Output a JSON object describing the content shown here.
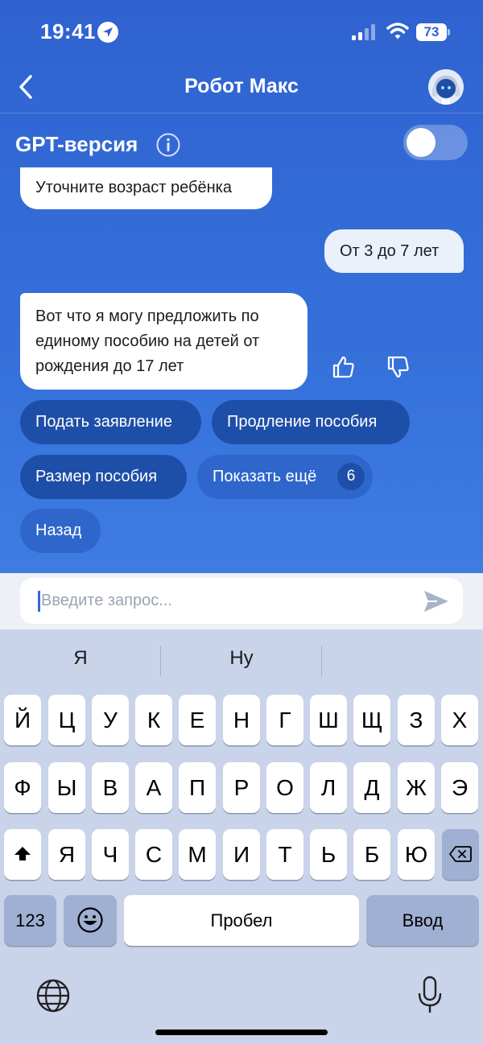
{
  "status_bar": {
    "time": "19:41",
    "battery": "73"
  },
  "header": {
    "title": "Робот Макс"
  },
  "gpt": {
    "label": "GPT-версия",
    "enabled": false
  },
  "chat": {
    "messages": [
      {
        "from": "bot",
        "text": "Уточните возраст ребёнка"
      },
      {
        "from": "user",
        "text": "От 3 до 7 лет"
      },
      {
        "from": "bot",
        "text": "Вот что я могу предложить по единому пособию на детей от рождения до 17 лет"
      }
    ],
    "quick_replies": [
      {
        "label": "Подать заявление"
      },
      {
        "label": "Продление пособия"
      },
      {
        "label": "Размер пособия"
      },
      {
        "label": "Показать ещё",
        "count": "6"
      },
      {
        "label": "Назад"
      }
    ]
  },
  "input": {
    "placeholder": "Введите запрос..."
  },
  "keyboard": {
    "suggestions": [
      "Я",
      "Ну"
    ],
    "row1": [
      "Й",
      "Ц",
      "У",
      "К",
      "Е",
      "Н",
      "Г",
      "Ш",
      "Щ",
      "З",
      "Х"
    ],
    "row2": [
      "Ф",
      "Ы",
      "В",
      "А",
      "П",
      "Р",
      "О",
      "Л",
      "Д",
      "Ж",
      "Э"
    ],
    "row3": [
      "Я",
      "Ч",
      "С",
      "М",
      "И",
      "Т",
      "Ь",
      "Б",
      "Ю"
    ],
    "numbers_label": "123",
    "space_label": "Пробел",
    "enter_label": "Ввод"
  },
  "icons": {
    "back": "chevron-left-icon",
    "avatar": "robot-avatar-icon",
    "info": "info-icon",
    "like": "thumbs-up-icon",
    "dislike": "thumbs-down-icon",
    "send": "send-icon",
    "shift": "shift-icon",
    "backspace": "backspace-icon",
    "emoji": "emoji-icon",
    "globe": "globe-icon",
    "mic": "microphone-icon"
  },
  "colors": {
    "header_blue": "#2f62d0",
    "chip_dark": "#1e4fa8",
    "chip_mid": "#2f66cc",
    "keyboard_bg": "#c9d3e9"
  }
}
